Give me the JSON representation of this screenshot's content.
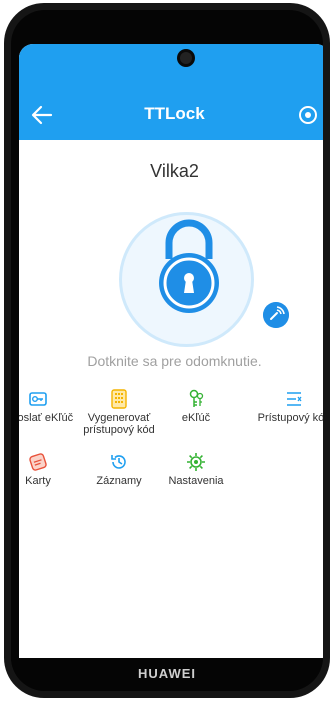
{
  "device": {
    "brand": "HUAWEI"
  },
  "header": {
    "title": "TTLock",
    "back_icon": "arrow-left-icon",
    "settings_icon": "settings-icon"
  },
  "lock": {
    "name": "Vilka2",
    "hint": "Dotknite sa pre odomknutie."
  },
  "menu": [
    {
      "label": "Odoslať eKľúč",
      "icon": "key-card-icon",
      "color": "#1f9ff0"
    },
    {
      "label": "Vygenerovať prístupový kód",
      "icon": "keypad-icon",
      "color": "#f4b400"
    },
    {
      "label": "eKľúč",
      "icon": "ekey-icon",
      "color": "#34b233"
    },
    {
      "label": "Prístupový kód",
      "icon": "passcode-list-icon",
      "color": "#1f9ff0"
    },
    {
      "label": "Karty",
      "icon": "card-icon",
      "color": "#e8513a"
    },
    {
      "label": "Záznamy",
      "icon": "history-icon",
      "color": "#1f9ff0"
    },
    {
      "label": "Nastavenia",
      "icon": "gear-icon",
      "color": "#34b233"
    }
  ],
  "colors": {
    "primary": "#1f9ff0",
    "background": "#ffffff",
    "hint": "#a0a0a0"
  }
}
